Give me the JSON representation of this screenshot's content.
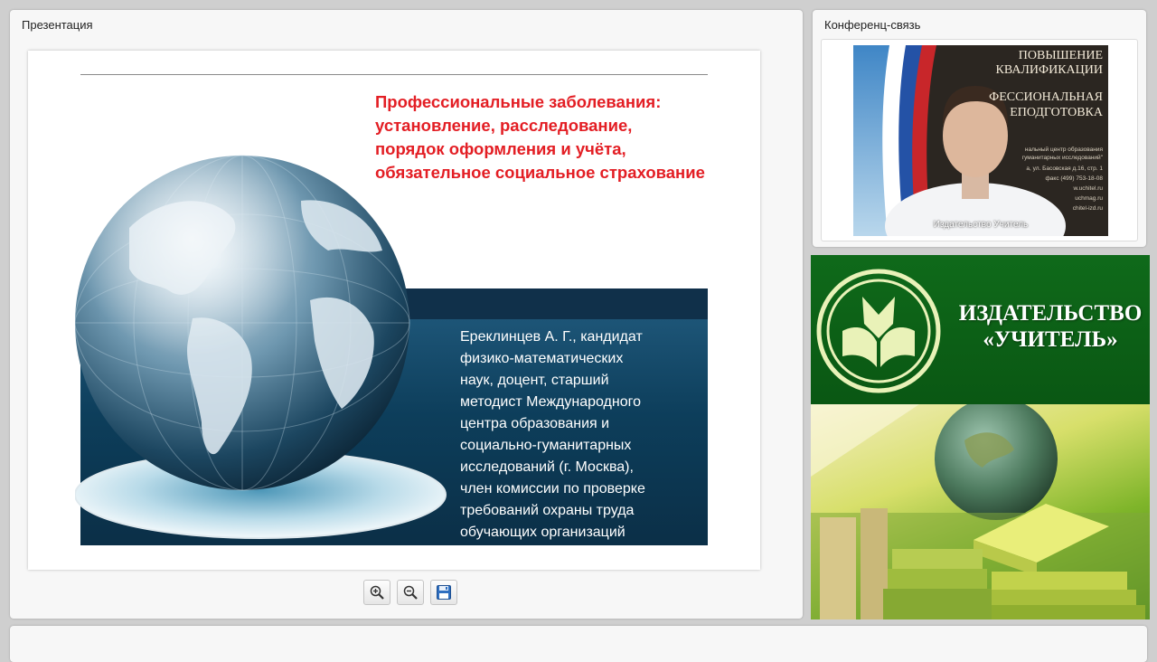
{
  "presentation": {
    "title": "Презентация",
    "slide": {
      "title_lines": [
        "Профессиональные заболевания:",
        "установление, расследование,",
        "порядок оформления и учёта,",
        "обязательное социальное страхование"
      ],
      "author_lines": [
        "Ереклинцев А. Г., кандидат",
        "физико-математических",
        "наук, доцент, старший",
        "методист Международного",
        "центра образования и",
        "социально-гуманитарных",
        "исследований (г. Москва),",
        "член комиссии по проверке",
        "требований охраны труда",
        "обучающих организаций"
      ]
    },
    "toolbar": {
      "zoom_in_icon": "zoom-in-icon",
      "zoom_out_icon": "zoom-out-icon",
      "save_icon": "floppy-disk-icon"
    }
  },
  "conference": {
    "title": "Конференц-связь",
    "speaker_name": "Издательство Учитель",
    "background_text": [
      "ПОВЫШЕНИЕ",
      "КВАЛИФИКАЦИИ",
      "ФЕССИОНАЛЬНАЯ",
      "ЕПОДГОТОВКА"
    ],
    "background_small": [
      "нальный центр образования",
      "гуманитарных исследований\"",
      "а, ул. Басовская д.16, стр. 1",
      "факс (499) 753-18-08",
      "w.uchitel.ru",
      "uchmag.ru",
      "chitel-izd.ru"
    ]
  },
  "publisher": {
    "name_line1": "ИЗДАТЕЛЬСТВО",
    "name_line2": "«УЧИТЕЛЬ»"
  },
  "colors": {
    "slide_title": "#e31e24",
    "slide_band": "#0d3e5b",
    "publisher_green": "#0f6a1a"
  }
}
